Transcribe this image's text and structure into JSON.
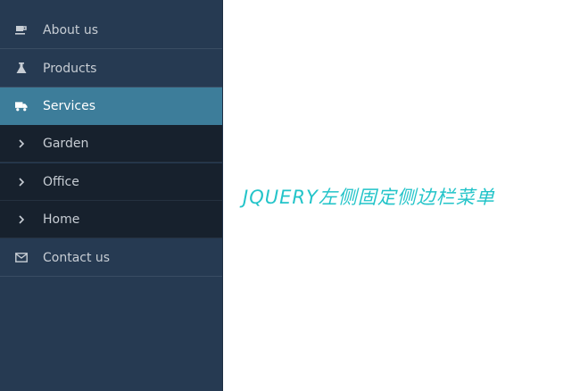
{
  "sidebar": {
    "items": [
      {
        "label": "About us",
        "icon": "coffee-cup-icon"
      },
      {
        "label": "Products",
        "icon": "flask-icon"
      },
      {
        "label": "Services",
        "icon": "truck-icon",
        "active": true
      },
      {
        "label": "Garden",
        "icon": "chevron-right-icon"
      },
      {
        "label": "Office",
        "icon": "chevron-right-icon"
      },
      {
        "label": "Home",
        "icon": "chevron-right-icon"
      },
      {
        "label": "Contact us",
        "icon": "envelope-icon"
      }
    ]
  },
  "main": {
    "headline": "JQUERY左侧固定侧边栏菜单"
  },
  "colors": {
    "sidebar_bg": "#263a52",
    "active_bg": "#3d7d9a",
    "submenu_bg": "#17212d",
    "headline": "#23c4c9"
  }
}
